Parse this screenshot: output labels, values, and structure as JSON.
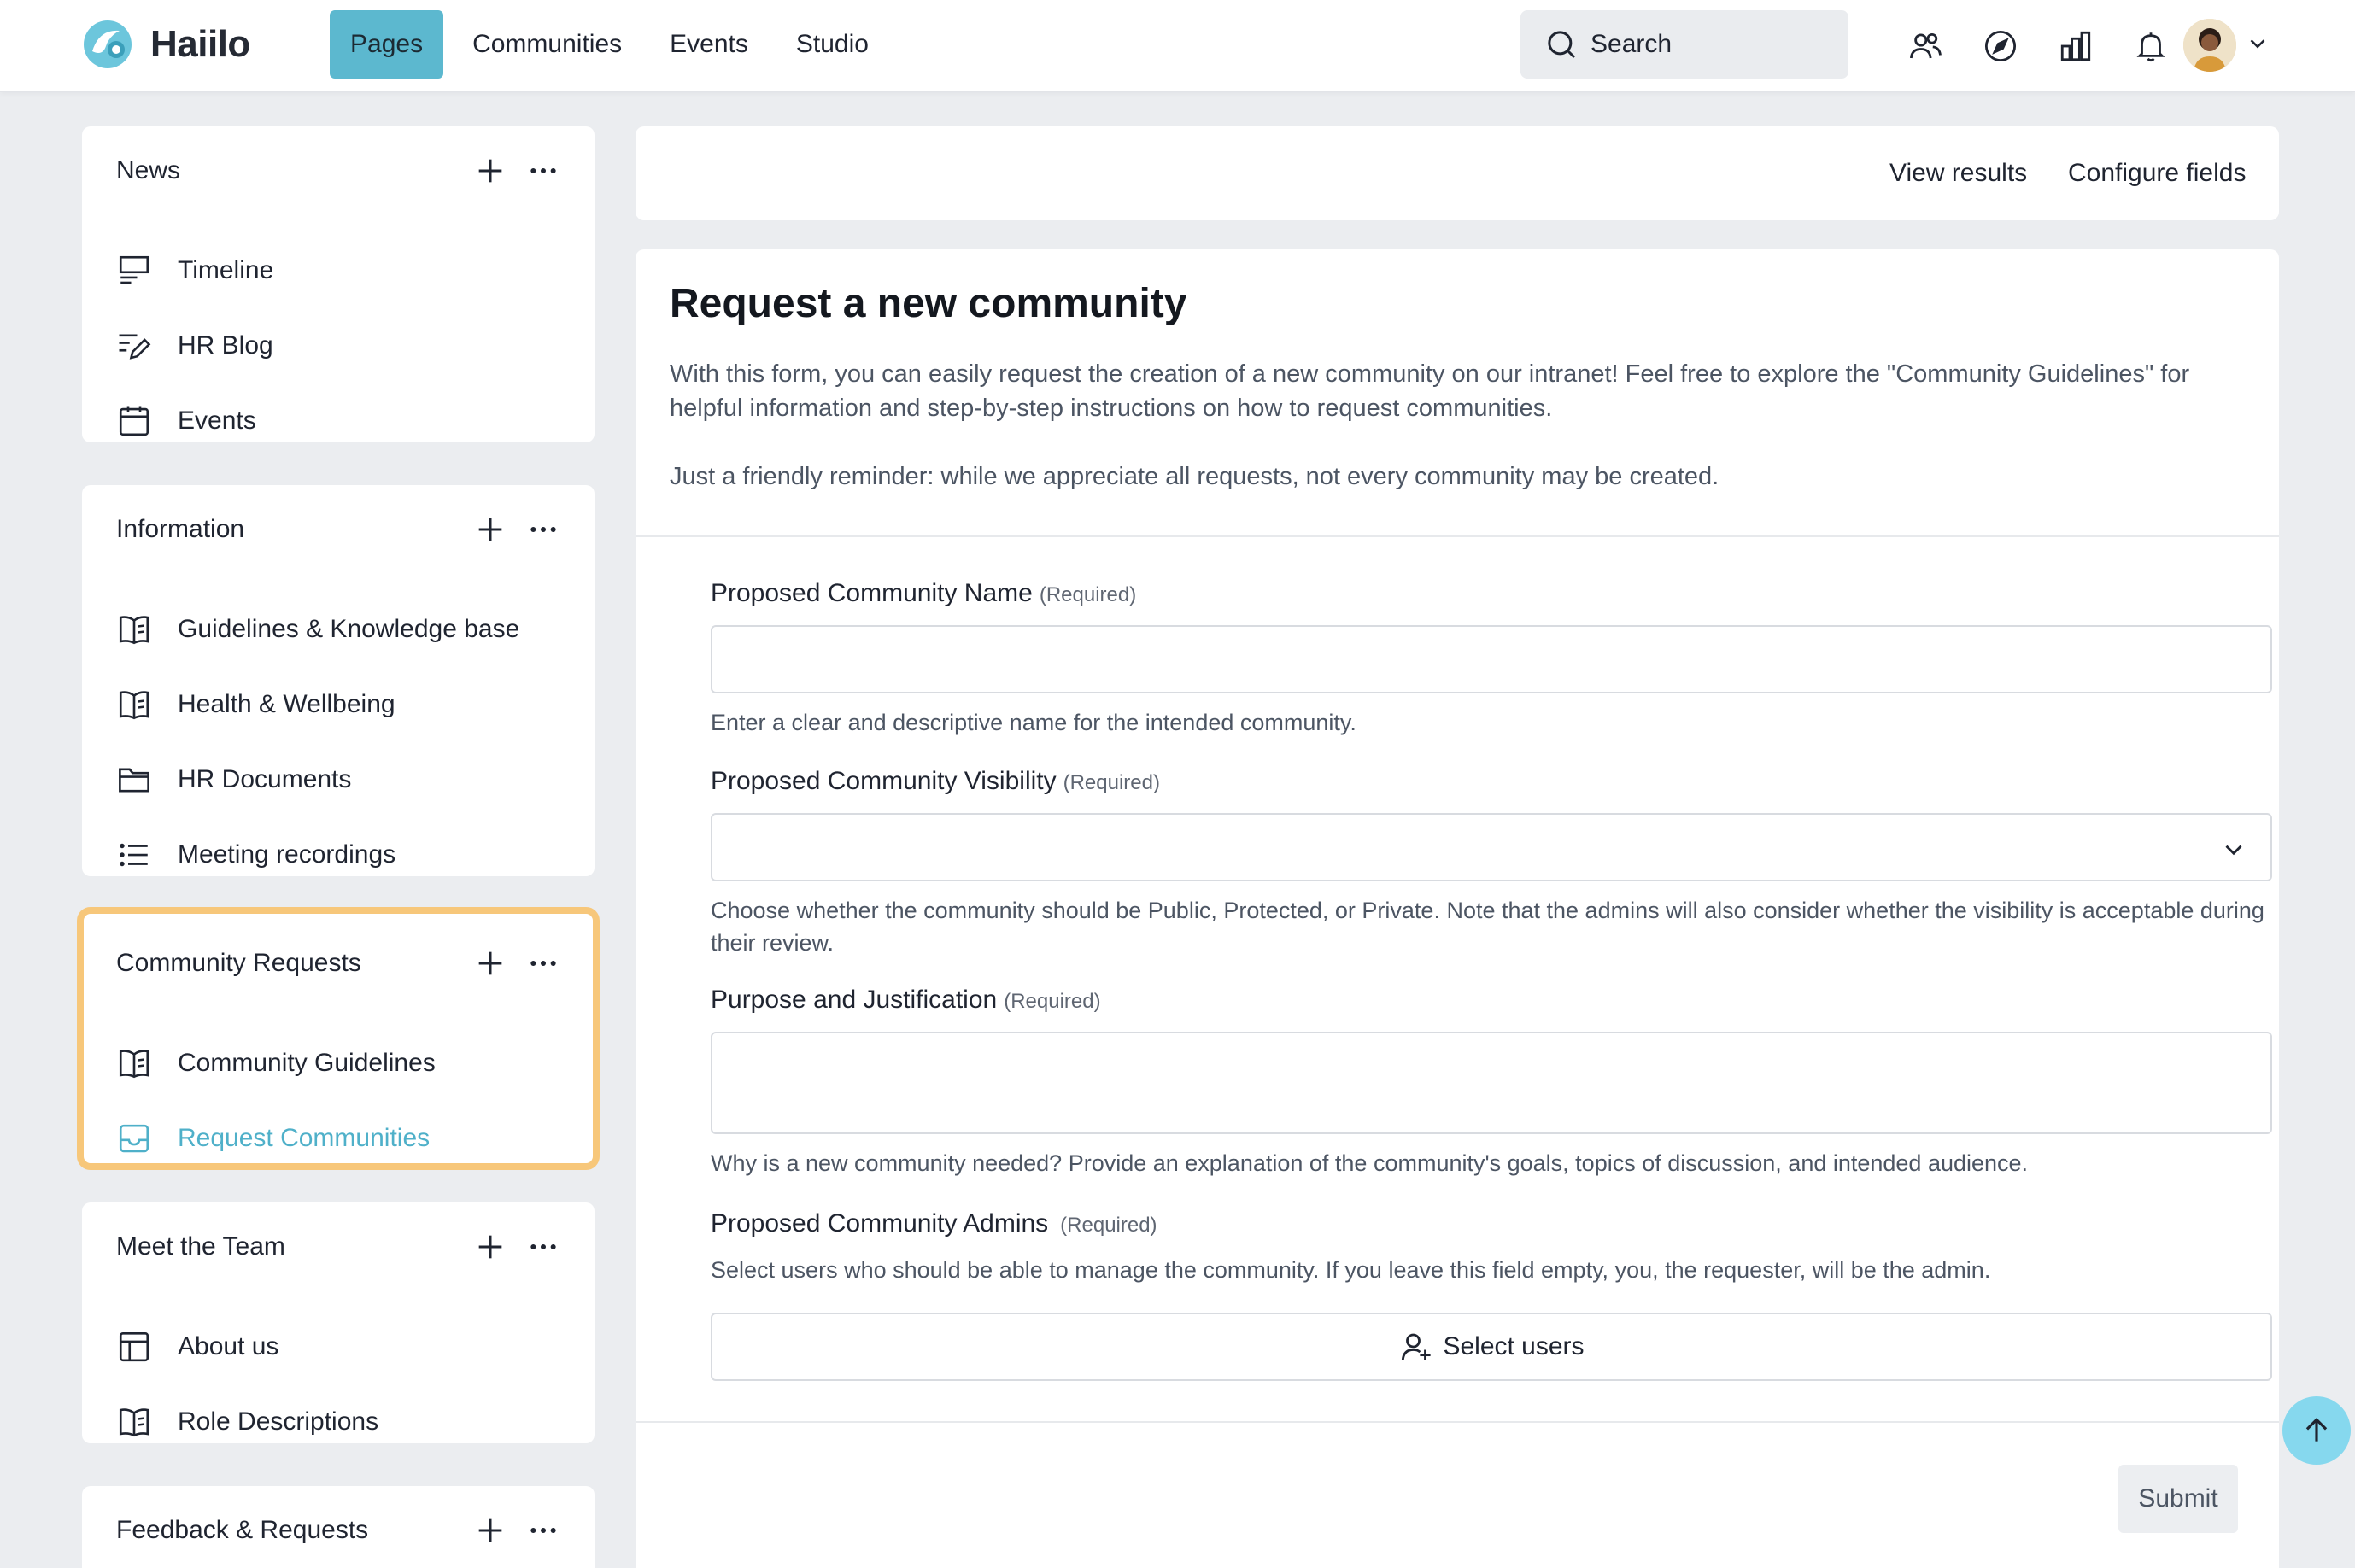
{
  "app": {
    "name": "Haiilo"
  },
  "nav": {
    "items": [
      "Pages",
      "Communities",
      "Events",
      "Studio"
    ],
    "active": "Pages"
  },
  "search": {
    "label": "Search"
  },
  "top_icons": [
    "people-icon",
    "compass-icon",
    "chart-icon",
    "bell-icon"
  ],
  "sidebar": [
    {
      "title": "News",
      "items": [
        {
          "label": "Timeline",
          "icon": "timeline-icon"
        },
        {
          "label": "HR Blog",
          "icon": "blog-icon"
        },
        {
          "label": "Events",
          "icon": "calendar-icon"
        }
      ]
    },
    {
      "title": "Information",
      "items": [
        {
          "label": "Guidelines & Knowledge base",
          "icon": "book-icon"
        },
        {
          "label": "Health & Wellbeing",
          "icon": "book-icon"
        },
        {
          "label": "HR Documents",
          "icon": "folder-icon"
        },
        {
          "label": "Meeting recordings",
          "icon": "list-icon"
        }
      ]
    },
    {
      "title": "Community Requests",
      "highlighted": true,
      "items": [
        {
          "label": "Community Guidelines",
          "icon": "book-icon"
        },
        {
          "label": "Request Communities",
          "icon": "inbox-icon",
          "active": true
        }
      ]
    },
    {
      "title": "Meet the Team",
      "items": [
        {
          "label": "About us",
          "icon": "layout-icon"
        },
        {
          "label": "Role Descriptions",
          "icon": "book-icon"
        }
      ]
    },
    {
      "title": "Feedback & Requests",
      "items": []
    }
  ],
  "toolbar": {
    "view_results": "View results",
    "configure_fields": "Configure fields"
  },
  "form": {
    "title": "Request a new community",
    "description": [
      "With this form, you can easily request the creation of a new community on our intranet! Feel free to explore the \"Community Guidelines\" for helpful information and step-by-step instructions on how to request communities.",
      "Just a friendly reminder: while we appreciate all requests, not every community may be created."
    ],
    "required_tag": "(Required)",
    "fields": {
      "name": {
        "label": "Proposed Community Name",
        "value": "",
        "hint": "Enter a clear and descriptive name for the intended community."
      },
      "visibility": {
        "label": "Proposed Community Visibility",
        "value": "",
        "hint": "Choose whether the community should be Public, Protected, or Private. Note that the admins will also consider whether the visibility is acceptable during their review."
      },
      "purpose": {
        "label": "Purpose and Justification",
        "value": "",
        "hint": "Why is a new community needed? Provide an explanation of the community's goals, topics of discussion, and intended audience."
      },
      "admins": {
        "label": "Proposed Community Admins",
        "hint": "Select users who should be able to manage the community. If you leave this field empty, you, the requester, will be the admin.",
        "button": "Select users"
      }
    },
    "submit": "Submit"
  },
  "colors": {
    "accent": "#5cb8cf",
    "highlight": "#f7c77a",
    "link": "#4fb0c9",
    "scroll_button": "#86d8ee"
  }
}
